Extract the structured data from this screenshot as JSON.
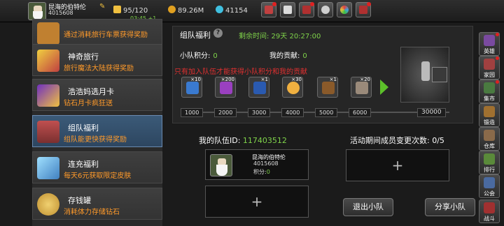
{
  "player": {
    "name": "昆海的伯特伦",
    "id_line": "4015608",
    "timer": "03:45 +1"
  },
  "resources": [
    {
      "icon": "lightning-icon",
      "value": "95/120",
      "color": "#f0c040"
    },
    {
      "icon": "coin-icon",
      "value": "89.26M",
      "color": "#e0a020"
    },
    {
      "icon": "gem-icon",
      "value": "41154",
      "color": "#40c0e0"
    }
  ],
  "toolbar": [
    "cart-icon",
    "mail-icon",
    "chest-icon",
    "gear-icon",
    "globe-icon",
    "notice-icon"
  ],
  "menu": [
    {
      "title": "",
      "desc": "通过消耗旅行车票获得奖励",
      "icon": "ticket-icon"
    },
    {
      "title": "神奇旅行",
      "desc": "旅行魔法大陆获得奖励",
      "icon": "travel-icon"
    },
    {
      "title": "浩浩妈选月卡",
      "desc": "钻石月卡疯狂送",
      "icon": "card-icon"
    },
    {
      "title": "组队福利",
      "desc": "组队能更快获得奖励",
      "icon": "treasure-chest-icon"
    },
    {
      "title": "连充福利",
      "desc": "每天6元获取限定皮肤",
      "icon": "crystal-icon"
    },
    {
      "title": "存钱罐",
      "desc": "消耗体力存储钻石",
      "icon": "piggy-bank-icon"
    }
  ],
  "panel": {
    "title": "组队福利",
    "time_label": "剩余时间: 29天 20:27:00",
    "team_points_label": "小队积分:",
    "team_points_value": "0",
    "contribution_label": "我的贡献:",
    "contribution_value": "0",
    "warning": "只有加入队伍才能获得小队积分和我的贡献",
    "rewards": [
      {
        "qty": "×10",
        "color": "#3a7ad0",
        "icon": "lightning-scroll-icon"
      },
      {
        "qty": "×200",
        "color": "#9a40c0",
        "icon": "magic-book-icon"
      },
      {
        "qty": "×1",
        "color": "#2a5ab0",
        "icon": "blue-gem-icon"
      },
      {
        "qty": "×30",
        "color": "#f0b040",
        "icon": "egg-icon"
      },
      {
        "qty": "×1",
        "color": "#8a5a2a",
        "icon": "torch-icon"
      },
      {
        "qty": "×20",
        "color": "#9a8a7a",
        "icon": "hammer-icon"
      }
    ],
    "milestones": [
      "1000",
      "2000",
      "3000",
      "4000",
      "5000",
      "6000",
      "30000"
    ]
  },
  "team": {
    "id_label": "我的队伍ID:",
    "id_value": "117403512",
    "changes_label": "活动期间成员变更次数: 0/5",
    "member": {
      "name": "昆海的伯特伦",
      "id": "4015608",
      "score_label": "积分:",
      "score_value": "0"
    },
    "plus": "+",
    "leave_button": "退出小队",
    "share_button": "分享小队"
  },
  "rail": [
    {
      "label": "英雄",
      "color": "#7a4aa0",
      "badge": true
    },
    {
      "label": "家园",
      "color": "#a04040",
      "badge": true
    },
    {
      "label": "集市",
      "color": "#4a7a40",
      "badge": true
    },
    {
      "label": "锻造",
      "color": "#a07030",
      "badge": false
    },
    {
      "label": "仓库",
      "color": "#8a6a4a",
      "badge": false
    },
    {
      "label": "排行",
      "color": "#5a8a3a",
      "badge": false
    },
    {
      "label": "公会",
      "color": "#4a6aa0",
      "badge": false
    },
    {
      "label": "战斗",
      "color": "#a03030",
      "badge": false
    }
  ]
}
